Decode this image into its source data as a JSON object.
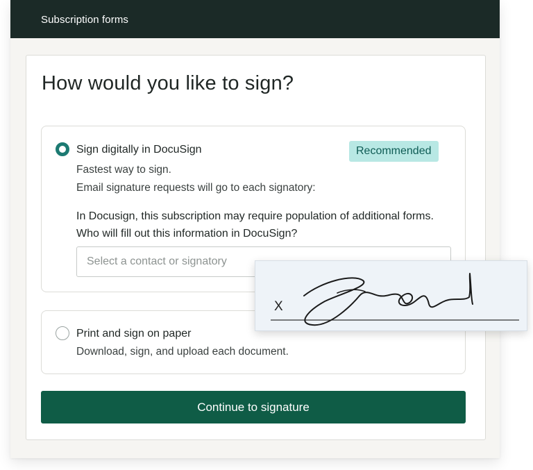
{
  "header": {
    "title": "Subscription forms"
  },
  "dialog": {
    "heading": "How would you like to sign?",
    "option_digital": {
      "title": "Sign digitally in DocuSign",
      "badge": "Recommended",
      "line1": "Fastest way to sign.",
      "line2": "Email signature requests will go to each signatory:",
      "question": "In Docusign, this subscription may require population of additional forms. Who will fill out this information in DocuSign?",
      "select_placeholder": "Select a contact or signatory",
      "selected": true
    },
    "option_paper": {
      "title": "Print and sign on paper",
      "description": "Download, sign, and upload each document.",
      "selected": false
    },
    "continue_label": "Continue to signature"
  },
  "signature_overlay": {
    "mark": "X"
  },
  "colors": {
    "header_bg": "#1b2a27",
    "primary_button": "#0f5c46",
    "radio_selected": "#1c7a72",
    "badge_bg": "#b8e8e4",
    "badge_text": "#0f5c55"
  }
}
